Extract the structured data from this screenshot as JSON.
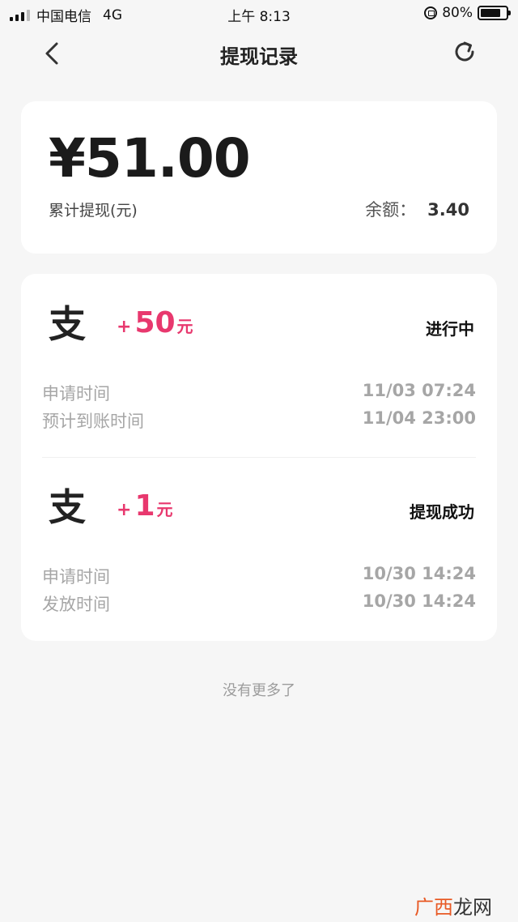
{
  "status_bar": {
    "carrier": "中国电信",
    "network": "4G",
    "time": "上午 8:13",
    "battery": "80%"
  },
  "nav": {
    "title": "提现记录",
    "back_icon": "chevron-left-icon",
    "refresh_icon": "refresh-icon"
  },
  "summary": {
    "total_amount": "¥51.00",
    "total_label": "累计提现(元)",
    "balance_label": "余额：",
    "balance_value": "3.40"
  },
  "records": [
    {
      "icon": "alipay-icon",
      "icon_glyph": "支",
      "plus": "+",
      "amount": "50",
      "unit": "元",
      "status": "进行中",
      "details": [
        {
          "label": "申请时间",
          "value": "11/03 07:24"
        },
        {
          "label": "预计到账时间",
          "value": "11/04 23:00"
        }
      ]
    },
    {
      "icon": "alipay-icon",
      "icon_glyph": "支",
      "plus": "+",
      "amount": "1",
      "unit": "元",
      "status": "提现成功",
      "details": [
        {
          "label": "申请时间",
          "value": "10/30 14:24"
        },
        {
          "label": "发放时间",
          "value": "10/30 14:24"
        }
      ]
    }
  ],
  "footer": {
    "no_more": "没有更多了"
  },
  "watermark": {
    "part1": "广西",
    "part2": "龙网"
  },
  "colors": {
    "accent": "#e8386e",
    "background": "#f6f6f6",
    "muted": "#a6a6a6"
  }
}
